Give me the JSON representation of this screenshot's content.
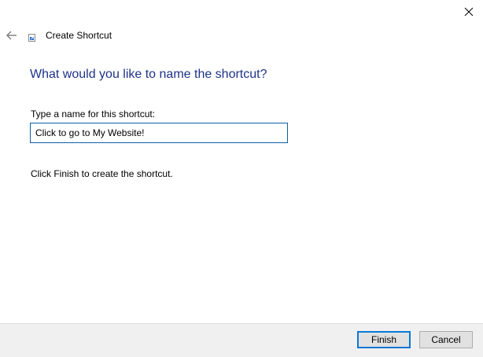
{
  "window": {
    "title": "Create Shortcut",
    "icons": {
      "close": "close-icon",
      "back": "back-arrow-icon",
      "app": "shortcut-icon"
    }
  },
  "main": {
    "heading": "What would you like to name the shortcut?",
    "field_label": "Type a name for this shortcut:",
    "name_value": "Click to go to My Website!",
    "instruction": "Click Finish to create the shortcut."
  },
  "footer": {
    "finish_label": "Finish",
    "cancel_label": "Cancel"
  },
  "colors": {
    "heading": "#1e3287",
    "focus_border": "#0a78d7",
    "footer_bg": "#f0f0f0"
  }
}
